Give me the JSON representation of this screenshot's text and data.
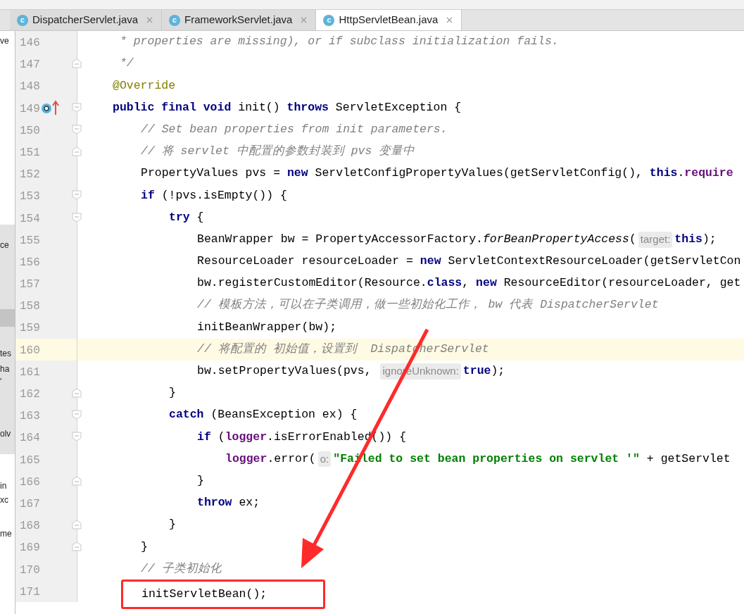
{
  "tabs": [
    {
      "icon_letter": "c",
      "label": "DispatcherServlet.java",
      "selected": false
    },
    {
      "icon_letter": "c",
      "label": "FrameworkServlet.java",
      "selected": false
    },
    {
      "icon_letter": "c",
      "label": "HttpServletBean.java",
      "selected": true
    }
  ],
  "left_panel": {
    "fragments": [
      "ve",
      "ce",
      "tes",
      "ha",
      "'",
      "olv",
      "in",
      "xc",
      "me"
    ]
  },
  "lines": [
    {
      "number": "146",
      "highlighted": false,
      "boxed": false,
      "tokens": [
        {
          "kind": "comment",
          "text": " * properties are missing), or if subclass initialization fails."
        }
      ]
    },
    {
      "number": "147",
      "highlighted": false,
      "boxed": false,
      "fold": {
        "kind": "close"
      },
      "tokens": [
        {
          "kind": "comment",
          "text": " */"
        }
      ]
    },
    {
      "number": "148",
      "highlighted": false,
      "boxed": false,
      "tokens": [
        {
          "kind": "annotation",
          "text": "@Override"
        }
      ]
    },
    {
      "number": "149",
      "highlighted": false,
      "boxed": false,
      "fold": {
        "kind": "open"
      },
      "gutter_icon": {
        "kind": "override"
      },
      "tokens": [
        {
          "kind": "keyword",
          "text": "public final void"
        },
        {
          "kind": "plain",
          "text": " init() "
        },
        {
          "kind": "keyword",
          "text": "throws"
        },
        {
          "kind": "plain",
          "text": " ServletException {"
        }
      ],
      "children": [
        {
          "number": "150",
          "highlighted": false,
          "boxed": false,
          "fold": {
            "kind": "open"
          },
          "tokens": [
            {
              "kind": "comment",
              "text": "// Set bean properties from init parameters."
            }
          ]
        },
        {
          "number": "151",
          "highlighted": false,
          "boxed": false,
          "fold": {
            "kind": "close"
          },
          "tokens": [
            {
              "kind": "comment",
              "text": "// 将 servlet 中配置的参数封装到 pvs 变量中"
            }
          ]
        },
        {
          "number": "152",
          "highlighted": false,
          "boxed": false,
          "tokens": [
            {
              "kind": "plain",
              "text": "PropertyValues pvs = "
            },
            {
              "kind": "keyword",
              "text": "new"
            },
            {
              "kind": "plain",
              "text": " ServletConfigPropertyValues(getServletConfig(), "
            },
            {
              "kind": "keyword",
              "text": "this"
            },
            {
              "kind": "plain",
              "text": "."
            },
            {
              "kind": "field",
              "text": "require"
            }
          ]
        },
        {
          "number": "153",
          "highlighted": false,
          "boxed": false,
          "fold": {
            "kind": "open"
          },
          "tokens": [
            {
              "kind": "keyword",
              "text": "if"
            },
            {
              "kind": "plain",
              "text": " (!pvs.isEmpty()) {"
            }
          ],
          "children": [
            {
              "number": "154",
              "highlighted": false,
              "boxed": false,
              "fold": {
                "kind": "open"
              },
              "tokens": [
                {
                  "kind": "keyword",
                  "text": "try"
                },
                {
                  "kind": "plain",
                  "text": " {"
                }
              ],
              "children": [
                {
                  "number": "155",
                  "highlighted": false,
                  "boxed": false,
                  "tokens": [
                    {
                      "kind": "plain",
                      "text": "BeanWrapper bw = PropertyAccessorFactory."
                    },
                    {
                      "kind": "static",
                      "text": "forBeanPropertyAccess"
                    },
                    {
                      "kind": "plain",
                      "text": "("
                    },
                    {
                      "kind": "hint",
                      "text": "target:"
                    },
                    {
                      "kind": "keyword",
                      "text": "this"
                    },
                    {
                      "kind": "plain",
                      "text": ");"
                    }
                  ]
                },
                {
                  "number": "156",
                  "highlighted": false,
                  "boxed": false,
                  "tokens": [
                    {
                      "kind": "plain",
                      "text": "ResourceLoader resourceLoader = "
                    },
                    {
                      "kind": "keyword",
                      "text": "new"
                    },
                    {
                      "kind": "plain",
                      "text": " ServletContextResourceLoader(getServletCon"
                    }
                  ]
                },
                {
                  "number": "157",
                  "highlighted": false,
                  "boxed": false,
                  "tokens": [
                    {
                      "kind": "plain",
                      "text": "bw.registerCustomEditor(Resource."
                    },
                    {
                      "kind": "keyword",
                      "text": "class"
                    },
                    {
                      "kind": "plain",
                      "text": ", "
                    },
                    {
                      "kind": "keyword",
                      "text": "new"
                    },
                    {
                      "kind": "plain",
                      "text": " ResourceEditor(resourceLoader, get"
                    }
                  ]
                },
                {
                  "number": "158",
                  "highlighted": false,
                  "boxed": false,
                  "tokens": [
                    {
                      "kind": "comment",
                      "text": "// 模板方法，可以在子类调用，做一些初始化工作， bw 代表 DispatcherServlet"
                    }
                  ]
                },
                {
                  "number": "159",
                  "highlighted": false,
                  "boxed": false,
                  "tokens": [
                    {
                      "kind": "plain",
                      "text": "initBeanWrapper(bw);"
                    }
                  ]
                },
                {
                  "number": "160",
                  "highlighted": true,
                  "boxed": false,
                  "tokens": [
                    {
                      "kind": "comment",
                      "text": "// 将配置的 初始值，设置到  DispatcherServlet"
                    }
                  ]
                },
                {
                  "number": "161",
                  "highlighted": false,
                  "boxed": false,
                  "tokens": [
                    {
                      "kind": "plain",
                      "text": "bw.setPropertyValues(pvs, "
                    },
                    {
                      "kind": "hint",
                      "text": "ignoreUnknown:"
                    },
                    {
                      "kind": "keyword",
                      "text": "true"
                    },
                    {
                      "kind": "plain",
                      "text": ");"
                    }
                  ]
                }
              ]
            },
            {
              "number": "162",
              "highlighted": false,
              "boxed": false,
              "fold": {
                "kind": "close"
              },
              "tokens": [
                {
                  "kind": "plain",
                  "text": "}"
                }
              ]
            },
            {
              "number": "163",
              "highlighted": false,
              "boxed": false,
              "fold": {
                "kind": "open"
              },
              "tokens": [
                {
                  "kind": "keyword",
                  "text": "catch"
                },
                {
                  "kind": "plain",
                  "text": " (BeansException ex) {"
                }
              ],
              "children": [
                {
                  "number": "164",
                  "highlighted": false,
                  "boxed": false,
                  "fold": {
                    "kind": "open"
                  },
                  "tokens": [
                    {
                      "kind": "keyword",
                      "text": "if"
                    },
                    {
                      "kind": "plain",
                      "text": " ("
                    },
                    {
                      "kind": "field",
                      "text": "logger"
                    },
                    {
                      "kind": "plain",
                      "text": ".isErrorEnabled()) {"
                    }
                  ],
                  "children": [
                    {
                      "number": "165",
                      "highlighted": false,
                      "boxed": false,
                      "tokens": [
                        {
                          "kind": "field",
                          "text": "logger"
                        },
                        {
                          "kind": "plain",
                          "text": ".error("
                        },
                        {
                          "kind": "hint",
                          "text": "o:"
                        },
                        {
                          "kind": "string",
                          "text": "\"Failed to set bean properties on servlet '\""
                        },
                        {
                          "kind": "plain",
                          "text": " + getServlet"
                        }
                      ]
                    }
                  ]
                },
                {
                  "number": "166",
                  "highlighted": false,
                  "boxed": false,
                  "fold": {
                    "kind": "close"
                  },
                  "tokens": [
                    {
                      "kind": "plain",
                      "text": "}"
                    }
                  ]
                },
                {
                  "number": "167",
                  "highlighted": false,
                  "boxed": false,
                  "tokens": [
                    {
                      "kind": "keyword",
                      "text": "throw"
                    },
                    {
                      "kind": "plain",
                      "text": " ex;"
                    }
                  ]
                }
              ]
            },
            {
              "number": "168",
              "highlighted": false,
              "boxed": false,
              "fold": {
                "kind": "close"
              },
              "tokens": [
                {
                  "kind": "plain",
                  "text": "}"
                }
              ]
            }
          ]
        },
        {
          "number": "169",
          "highlighted": false,
          "boxed": false,
          "fold": {
            "kind": "close"
          },
          "tokens": [
            {
              "kind": "plain",
              "text": "}"
            }
          ]
        },
        {
          "number": "170",
          "highlighted": false,
          "boxed": false,
          "tokens": [
            {
              "kind": "comment",
              "text": "// 子类初始化"
            }
          ]
        },
        {
          "number": "171",
          "highlighted": false,
          "boxed": true,
          "tokens": [
            {
              "kind": "plain",
              "text": "initServletBean();"
            }
          ]
        }
      ]
    }
  ]
}
